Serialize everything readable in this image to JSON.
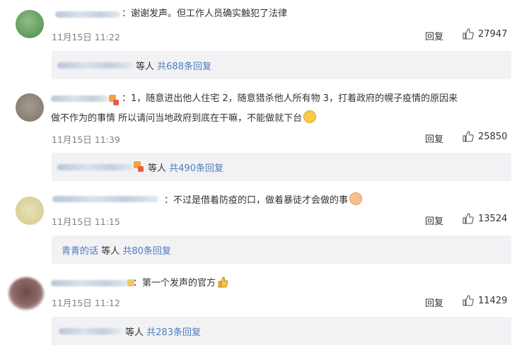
{
  "comments": [
    {
      "text": "：谢谢发声。但工作人员确实触犯了法律",
      "time": "11月15日 11:22",
      "reply_label": "回复",
      "likes": "27947",
      "reply_box": {
        "suffix": "等人",
        "link": "共688条回复"
      }
    },
    {
      "text_line1": "：1，随意进出他人住宅 2，随意猎杀他人所有物 3，打着政府的幌子疫情的原因来",
      "text_line2": "做不作为的事情 所以请问当地政府到底在干嘛，不能做就下台",
      "time": "11月15日 11:39",
      "reply_label": "回复",
      "likes": "25850",
      "reply_box": {
        "suffix": "等人",
        "link": "共490条回复"
      }
    },
    {
      "text": "：不过是借着防疫的口，做着暴徒才会做的事",
      "time": "11月15日 11:15",
      "reply_label": "回复",
      "likes": "13524",
      "reply_box": {
        "name": "青青的话",
        "suffix": "等人",
        "link": "共80条回复"
      }
    },
    {
      "text": "：第一个发声的官方",
      "time": "11月15日 11:12",
      "reply_label": "回复",
      "likes": "11429",
      "reply_box": {
        "suffix": "等人",
        "link": "共283条回复"
      }
    }
  ],
  "colors": {
    "link": "#4f7cbf",
    "meta": "#808080",
    "reply_bg": "#f2f2f5"
  },
  "icons": [
    "thumbs-up-icon",
    "grin-emoji-icon",
    "blush-emoji-icon",
    "thumbs-up-emoji-icon",
    "vip-badge-icon"
  ]
}
